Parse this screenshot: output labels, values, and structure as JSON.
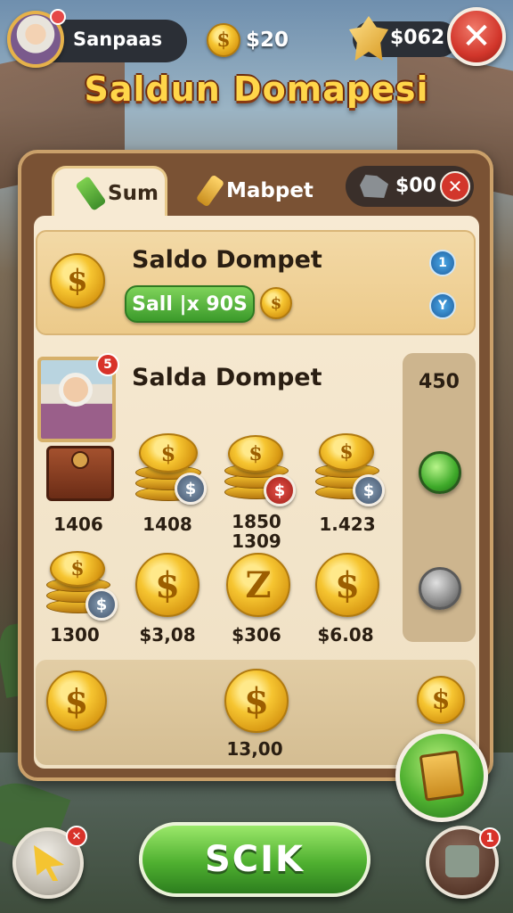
{
  "header": {
    "player_name": "Sanpaas",
    "coin_symbol": "$",
    "coin_amount": "$20",
    "gem_amount": "$062",
    "close_symbol": "✕"
  },
  "title": "Saldun Domapesi",
  "tabs": [
    {
      "label": "Sum",
      "active": true
    },
    {
      "label": "Mabpet",
      "active": false
    }
  ],
  "currency_pill": {
    "amount": "$00",
    "close_symbol": "✕"
  },
  "saldo_card": {
    "title": "Saldo Dompet",
    "button_label": "Sall |x 90S",
    "coin_symbol": "$",
    "badges": [
      "1",
      "Y"
    ]
  },
  "grid": {
    "title": "Salda Dompet",
    "avatar_badge": "5",
    "side_count": "450",
    "row1": [
      {
        "value": "1406"
      },
      {
        "value": "1408",
        "badge": "$"
      },
      {
        "value": "1850\n1309",
        "badge": "$"
      },
      {
        "value": "1.423",
        "badge": "$"
      }
    ],
    "row2": [
      {
        "value": "1300",
        "badge": "$"
      },
      {
        "value": "$3,08",
        "symbol": "$"
      },
      {
        "value": "$306",
        "symbol": "Z"
      },
      {
        "value": "$6.08",
        "symbol": "$"
      }
    ]
  },
  "bottom_strip": {
    "value": "13,00",
    "coin_symbol": "$"
  },
  "actions": {
    "main_button_label": "SCIK",
    "cursor_badge": "✕",
    "puzzle_badge": "1"
  },
  "colors": {
    "accent_green": "#4fb030",
    "close_red": "#d2362b",
    "coin_gold": "#f6c531",
    "panel_brown": "#7a5234"
  }
}
